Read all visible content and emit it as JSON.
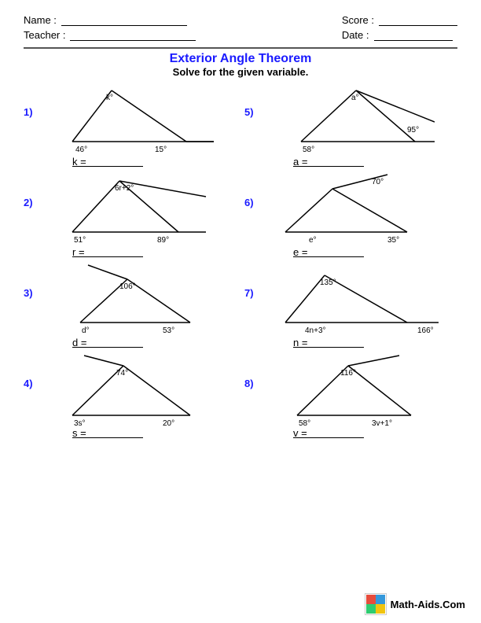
{
  "header": {
    "name_label": "Name :",
    "teacher_label": "Teacher :",
    "score_label": "Score :",
    "date_label": "Date :"
  },
  "title": "Exterior Angle Theorem",
  "subtitle": "Solve for the given variable.",
  "problems": [
    {
      "number": "1)",
      "variable": "k",
      "answer_label": "k = "
    },
    {
      "number": "5)",
      "variable": "a",
      "answer_label": "a = "
    },
    {
      "number": "2)",
      "variable": "r",
      "answer_label": "r = "
    },
    {
      "number": "6)",
      "variable": "e",
      "answer_label": "e = "
    },
    {
      "number": "3)",
      "variable": "d",
      "answer_label": "d = "
    },
    {
      "number": "7)",
      "variable": "n",
      "answer_label": "n = "
    },
    {
      "number": "4)",
      "variable": "s",
      "answer_label": "s = "
    },
    {
      "number": "8)",
      "variable": "v",
      "answer_label": "v = "
    }
  ],
  "watermark_text": "Math-Aids.Com"
}
